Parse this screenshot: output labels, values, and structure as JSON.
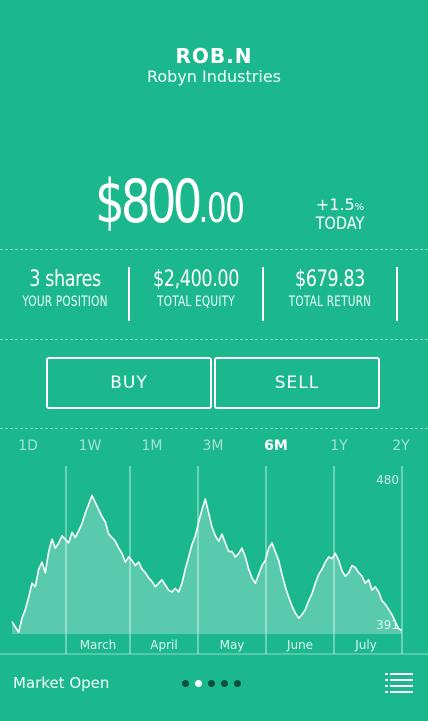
{
  "stock": {
    "ticker": "ROB.N",
    "company": "Robyn Industries",
    "price_dollars": "$800",
    "price_cents": ".00",
    "change_value": "+1.5",
    "change_unit": "%",
    "change_period": "TODAY"
  },
  "stats": [
    {
      "value": "3 shares",
      "label": "YOUR POSITION"
    },
    {
      "value": "$2,400.00",
      "label": "TOTAL EQUITY"
    },
    {
      "value": "$679.83",
      "label": "TOTAL RETURN"
    }
  ],
  "actions": {
    "buy_label": "BUY",
    "sell_label": "SELL"
  },
  "ranges": [
    "1D",
    "1W",
    "1M",
    "3M",
    "6M",
    "1Y",
    "2Y"
  ],
  "active_range": "6M",
  "chart_data": {
    "type": "area",
    "x_labels": [
      "March",
      "April",
      "May",
      "June",
      "July"
    ],
    "ylim": [
      391,
      480
    ],
    "y_tick_labels": [
      "480",
      "391"
    ],
    "values": [
      398,
      395,
      392,
      400,
      405,
      412,
      420,
      418,
      428,
      432,
      426,
      438,
      445,
      440,
      443,
      447,
      445,
      443,
      449,
      446,
      450,
      454,
      460,
      465,
      470,
      466,
      462,
      458,
      455,
      448,
      446,
      444,
      440,
      437,
      432,
      435,
      433,
      430,
      432,
      428,
      426,
      423,
      421,
      418,
      420,
      422,
      419,
      416,
      415,
      417,
      415,
      420,
      428,
      435,
      442,
      447,
      455,
      462,
      468,
      460,
      452,
      447,
      444,
      448,
      443,
      438,
      438,
      435,
      437,
      440,
      435,
      428,
      423,
      420,
      425,
      430,
      433,
      440,
      443,
      438,
      433,
      425,
      418,
      412,
      407,
      403,
      400,
      402,
      405,
      410,
      414,
      420,
      425,
      428,
      432,
      435,
      434,
      437,
      433,
      427,
      424,
      426,
      430,
      429,
      426,
      424,
      420,
      422,
      416,
      418,
      415,
      410,
      408,
      405,
      402,
      398,
      394,
      393
    ]
  },
  "footer": {
    "market_status": "Market Open",
    "pages": 5,
    "active_page": 1
  },
  "colors": {
    "background": "#1ab88c",
    "foreground": "#ffffff",
    "pager_inactive": "#0d4f3c"
  },
  "icons": {
    "menu": "list-icon"
  }
}
